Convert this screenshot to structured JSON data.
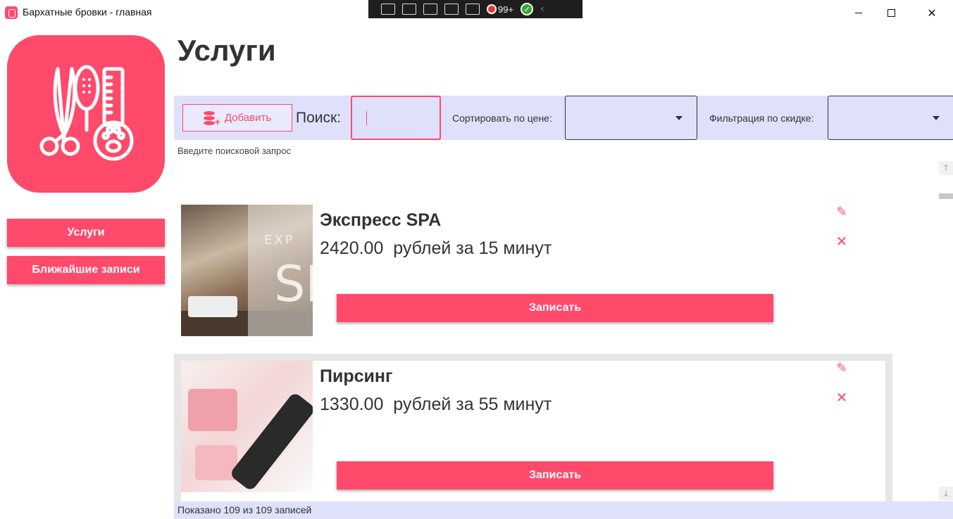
{
  "window": {
    "title": "Бархатные бровки - главная"
  },
  "debug_toolbar": {
    "count": "99+"
  },
  "sidebar": {
    "logo": "salon-tools-logo",
    "items": [
      {
        "label": "Услуги"
      },
      {
        "label": "Ближайшие записи"
      }
    ]
  },
  "header": {
    "title": "Услуги"
  },
  "toolbar": {
    "add_label": "Добавить",
    "search_label": "Поиск:",
    "search_value": "",
    "sort_label": "Сортировать по цене:",
    "sort_value": "",
    "filter_label": "Фильтрация по скидке:",
    "filter_value": ""
  },
  "search_hint": "Введите поисковой запрос",
  "services": [
    {
      "name": "Экспресс SPA",
      "price_line": "2420.00  рублей за 15 минут",
      "image_letters": "EXP",
      "image_big": "SP",
      "book_label": "Записать"
    },
    {
      "name": "Пирсинг",
      "price_line": "1330.00  рублей за 55 минут",
      "book_label": "Записать"
    }
  ],
  "status": {
    "text": "Показано 109 из 109 записей"
  },
  "colors": {
    "accent": "#ff4a6b",
    "toolbar_bg": "#dfe0fa"
  }
}
